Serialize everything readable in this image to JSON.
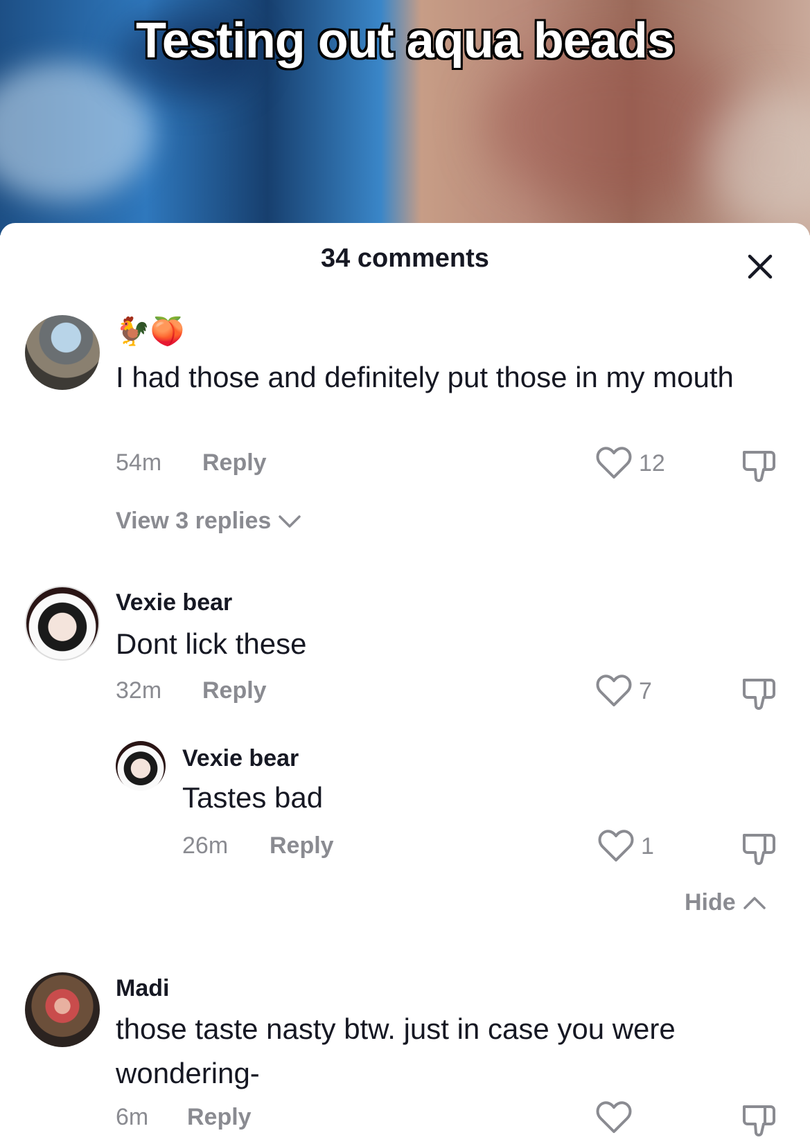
{
  "video": {
    "caption": "Testing out aqua beads"
  },
  "panel": {
    "title": "34 comments"
  },
  "comments": [
    {
      "username": "🐓🍑",
      "text": "I had those and definitely put those in my mouth",
      "time": "54m",
      "reply_label": "Reply",
      "likes": "12",
      "view_replies": "View 3 replies"
    },
    {
      "username": "Vexie bear",
      "text": "Dont lick these",
      "time": "32m",
      "reply_label": "Reply",
      "likes": "7"
    },
    {
      "username": "Vexie bear",
      "text": "Tastes bad",
      "time": "26m",
      "reply_label": "Reply",
      "likes": "1",
      "hide_label": "Hide"
    },
    {
      "username": "Madi",
      "text": "those taste nasty btw. just in case you were wondering-",
      "time": "6m",
      "reply_label": "Reply",
      "likes": ""
    }
  ]
}
